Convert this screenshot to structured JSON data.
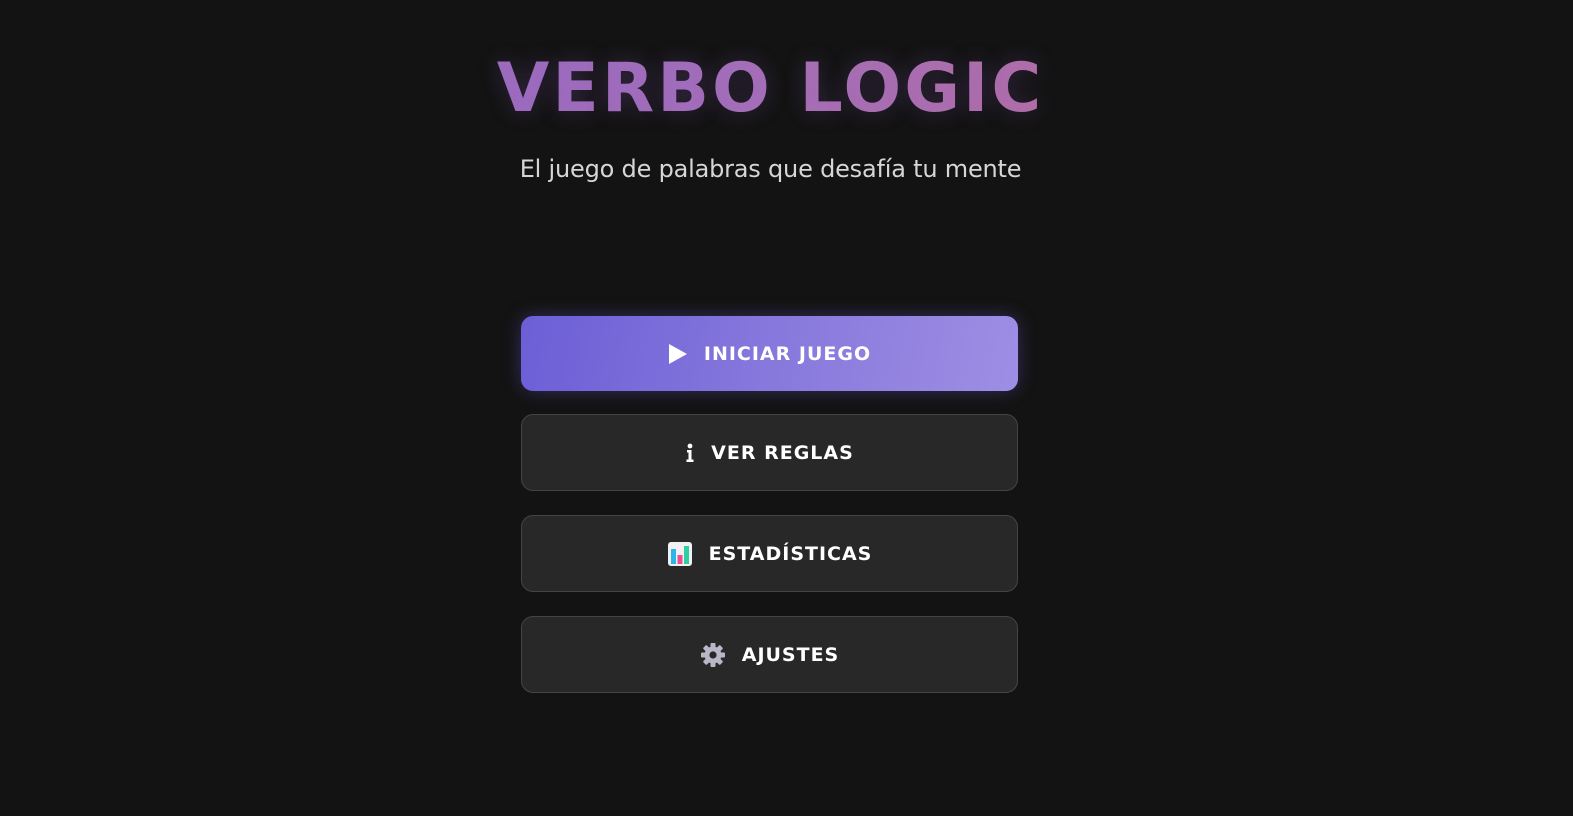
{
  "header": {
    "title": "VERBO LOGIC",
    "subtitle": "El juego de palabras que desafía tu mente"
  },
  "menu": {
    "start": {
      "label": "INICIAR JUEGO",
      "icon": "play-icon"
    },
    "rules": {
      "label": "VER REGLAS",
      "icon": "info-icon"
    },
    "stats": {
      "label": "ESTADÍSTICAS",
      "icon": "bar-chart-icon"
    },
    "settings": {
      "label": "AJUSTES",
      "icon": "gear-icon"
    }
  },
  "colors": {
    "background": "#131313",
    "primary_button_start": "#6c5ed6",
    "primary_button_end": "#9f8ee4",
    "secondary_button": "#282828",
    "title_gradient_start": "#8a63c4",
    "title_gradient_end": "#c66f8a"
  }
}
